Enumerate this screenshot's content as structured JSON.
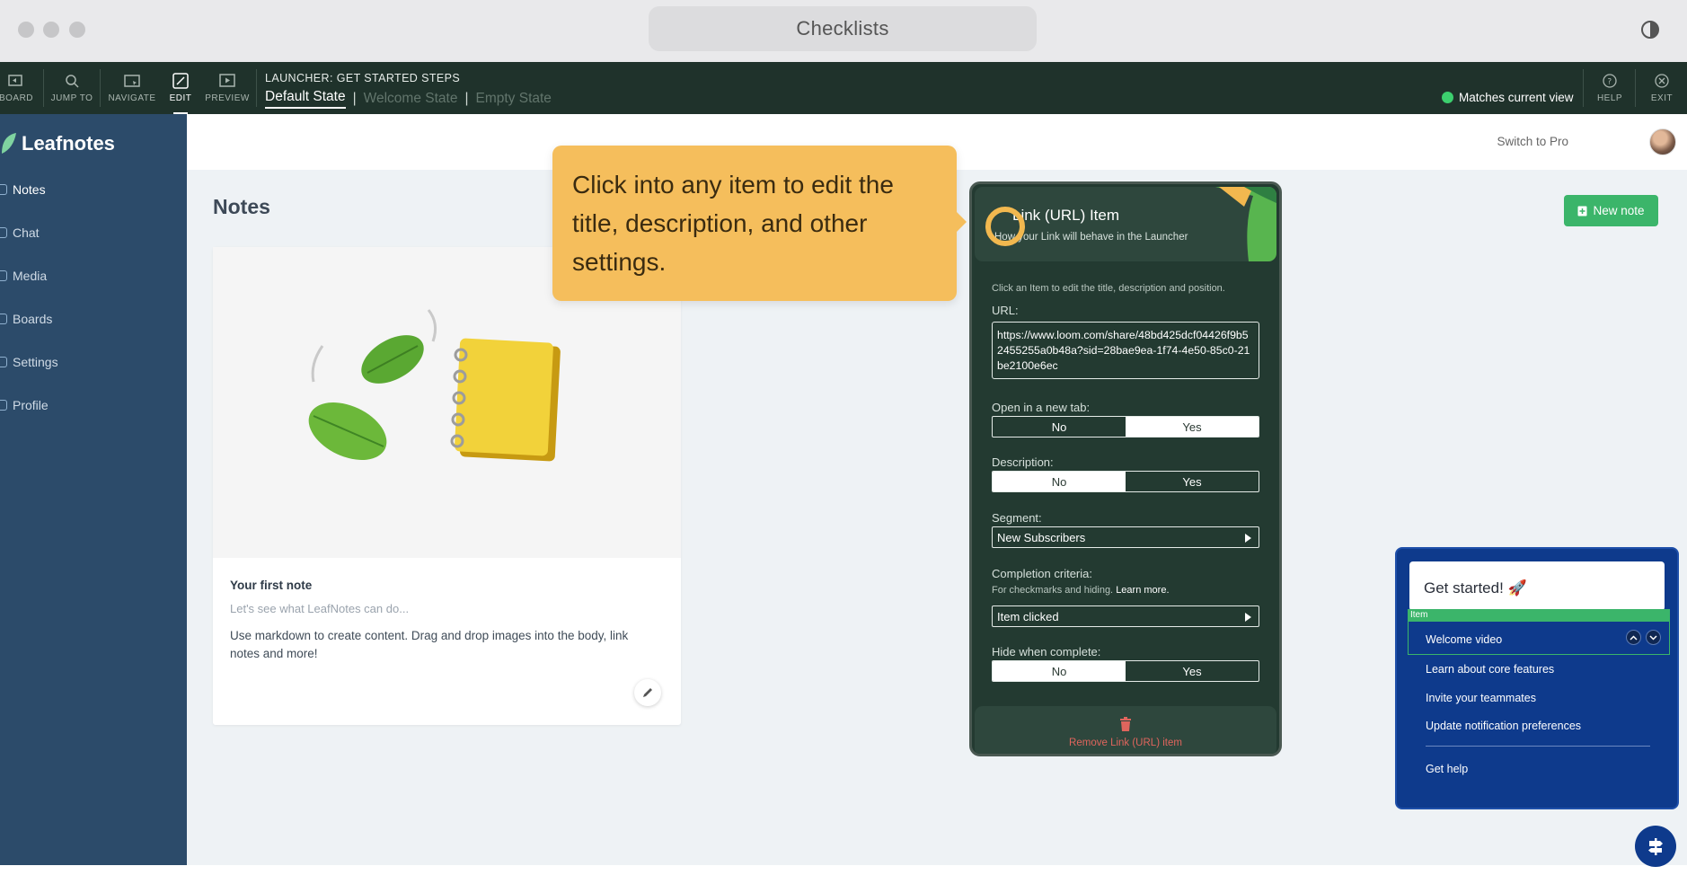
{
  "window": {
    "title": "Checklists"
  },
  "toolbar": {
    "tools": [
      {
        "label": "BOARD",
        "icon": "dashboard-icon"
      },
      {
        "label": "JUMP TO",
        "icon": "search-icon"
      },
      {
        "label": "NAVIGATE",
        "icon": "navigate-icon"
      },
      {
        "label": "EDIT",
        "icon": "edit-icon"
      },
      {
        "label": "PREVIEW",
        "icon": "play-icon"
      }
    ],
    "launcher_label": "LAUNCHER: GET STARTED STEPS",
    "states": [
      "Default State",
      "Welcome State",
      "Empty State"
    ],
    "separator": "|",
    "matches_label": "Matches current view",
    "help_label": "HELP",
    "exit_label": "EXIT"
  },
  "sidebar": {
    "brand": "Leafnotes",
    "items": [
      {
        "label": "Notes"
      },
      {
        "label": "Chat"
      },
      {
        "label": "Media"
      },
      {
        "label": "Boards"
      },
      {
        "label": "Settings"
      },
      {
        "label": "Profile"
      }
    ]
  },
  "header": {
    "switch_pro": "Switch to Pro"
  },
  "main": {
    "title": "Notes",
    "new_note_label": "New note",
    "note": {
      "title": "Your first note",
      "subtitle": "Let's see what LeafNotes can do...",
      "body": "Use markdown to create content. Drag and drop images into the body, link notes and more!"
    }
  },
  "tooltip": {
    "text": "Click into any item to edit the title, description, and other settings."
  },
  "panel": {
    "title": "Link (URL) Item",
    "subtitle": "How your Link will behave in the Launcher",
    "hint": "Click an Item to edit the title, description and position.",
    "url_label": "URL:",
    "url_value": "https://www.loom.com/share/48bd425dcf04426f9b52455255a0b48a?sid=28bae9ea-1f74-4e50-85c0-21be2100e6ec",
    "new_tab_label": "Open in a new tab:",
    "description_label": "Description:",
    "segment_label": "Segment:",
    "segment_value": "New Subscribers",
    "completion_label": "Completion criteria:",
    "completion_hint": "For checkmarks and hiding.",
    "learn_more": "Learn more.",
    "completion_value": "Item clicked",
    "hide_label": "Hide when complete:",
    "no": "No",
    "yes": "Yes",
    "remove_label": "Remove Link (URL) item"
  },
  "checklist": {
    "title": "Get started! 🚀",
    "item_tag": "Item",
    "items": [
      "Welcome video",
      "Learn about core features",
      "Invite your teammates",
      "Update notification preferences"
    ],
    "help": "Get help"
  },
  "colors": {
    "toolbar_bg": "#1f322b",
    "sidebar_bg": "#2c4b6a",
    "accent_green": "#3bb56a",
    "tooltip_bg": "#f5be5c",
    "panel_bg": "#233a31",
    "checklist_bg": "#0e3a8c"
  }
}
